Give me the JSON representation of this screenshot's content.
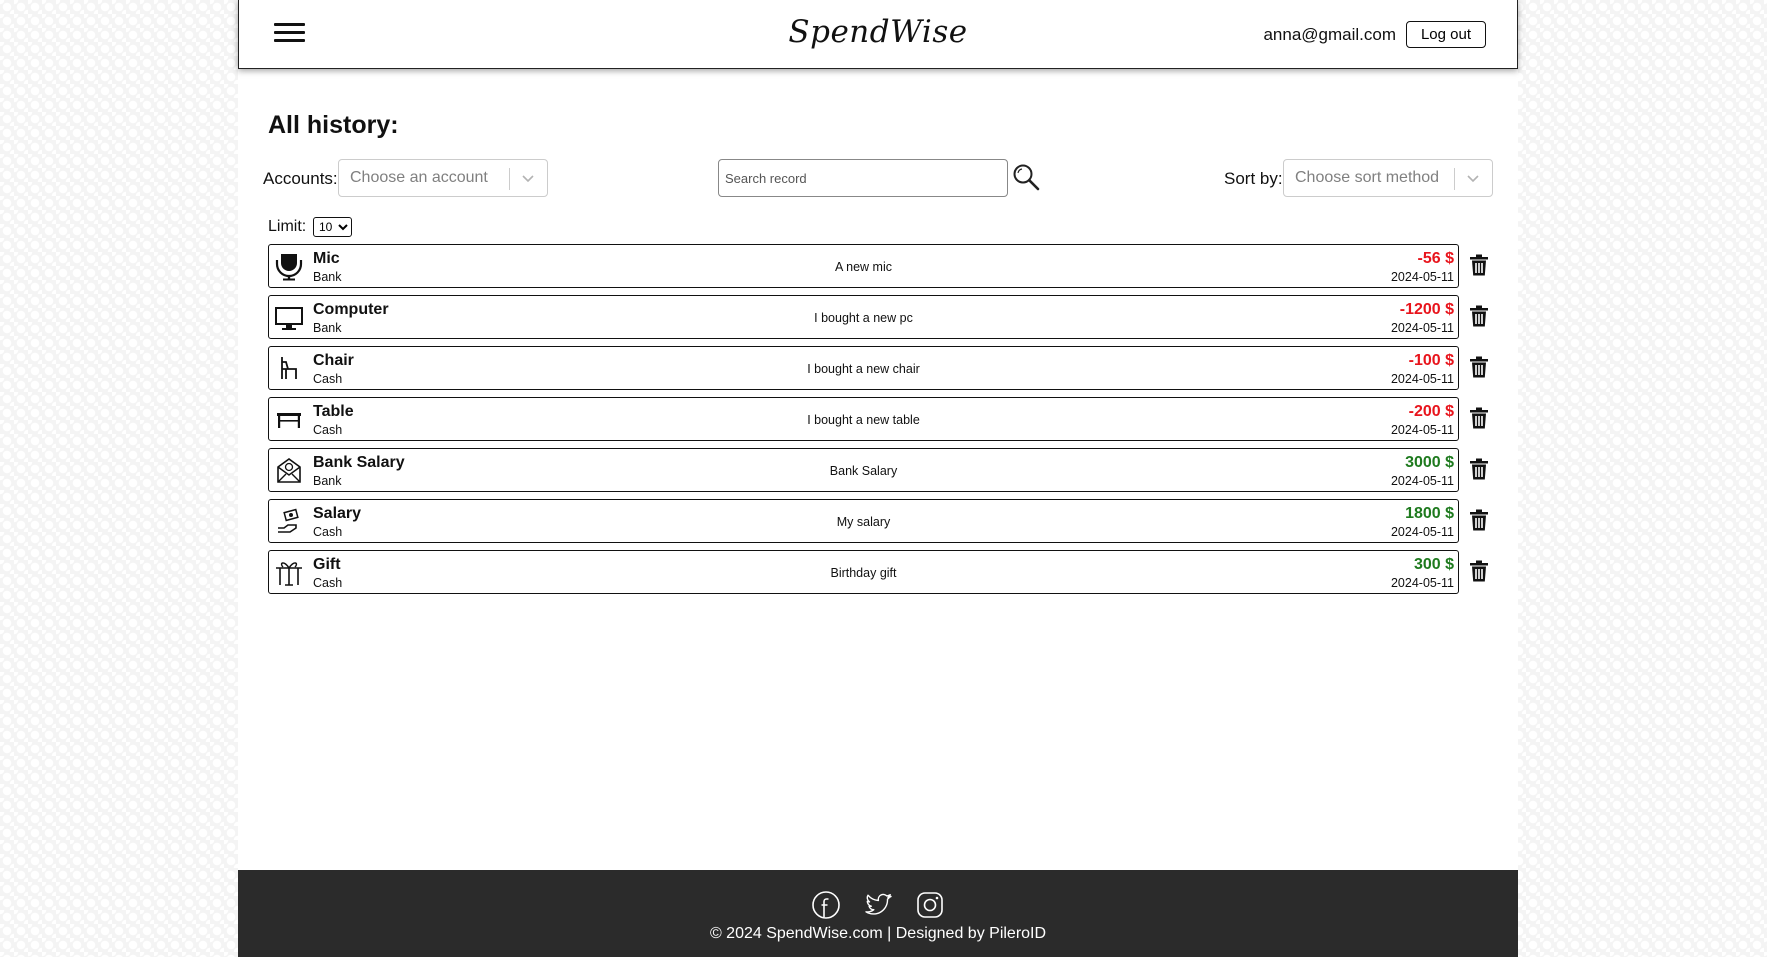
{
  "header": {
    "brand": "SpendWise",
    "user_email": "anna@gmail.com",
    "logout_label": "Log out"
  },
  "main": {
    "title": "All history:",
    "accounts_label": "Accounts:",
    "accounts_placeholder": "Choose an account",
    "search_placeholder": "Search record",
    "sort_label": "Sort by:",
    "sort_placeholder": "Choose sort method",
    "limit_label": "Limit:",
    "limit_value": "10"
  },
  "records": [
    {
      "name": "Mic",
      "account": "Bank",
      "description": "A new mic",
      "amount": "-56 $",
      "date": "2024-05-11",
      "type": "expense",
      "icon": "microphone-icon"
    },
    {
      "name": "Computer",
      "account": "Bank",
      "description": "I bought a new pc",
      "amount": "-1200 $",
      "date": "2024-05-11",
      "type": "expense",
      "icon": "monitor-icon"
    },
    {
      "name": "Chair",
      "account": "Cash",
      "description": "I bought a new chair",
      "amount": "-100 $",
      "date": "2024-05-11",
      "type": "expense",
      "icon": "chair-icon"
    },
    {
      "name": "Table",
      "account": "Cash",
      "description": "I bought a new table",
      "amount": "-200 $",
      "date": "2024-05-11",
      "type": "expense",
      "icon": "table-icon"
    },
    {
      "name": "Bank Salary",
      "account": "Bank",
      "description": "Bank Salary",
      "amount": "3000 $",
      "date": "2024-05-11",
      "type": "income",
      "icon": "salary-envelope-icon"
    },
    {
      "name": "Salary",
      "account": "Cash",
      "description": "My salary",
      "amount": "1800 $",
      "date": "2024-05-11",
      "type": "income",
      "icon": "cash-hand-icon"
    },
    {
      "name": "Gift",
      "account": "Cash",
      "description": "Birthday gift",
      "amount": "300 $",
      "date": "2024-05-11",
      "type": "income",
      "icon": "gift-icon"
    }
  ],
  "footer": {
    "copyright": "© 2024 SpendWise.com | Designed by PileroID",
    "socials": [
      "facebook-icon",
      "twitter-icon",
      "instagram-icon"
    ]
  },
  "colors": {
    "expense": "#e8141c",
    "income": "#1e7a1e",
    "footer_bg": "#2b2b2b"
  }
}
